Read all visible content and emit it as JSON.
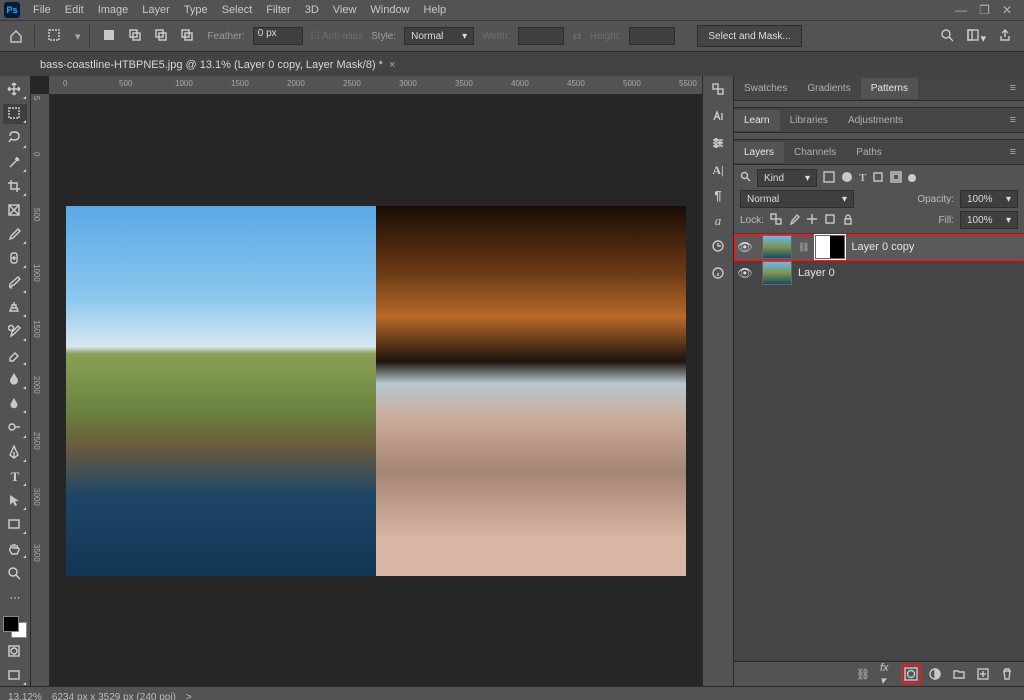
{
  "app": {
    "logo": "Ps"
  },
  "menu": [
    "File",
    "Edit",
    "Image",
    "Layer",
    "Type",
    "Select",
    "Filter",
    "3D",
    "View",
    "Window",
    "Help"
  ],
  "options": {
    "feather_label": "Feather:",
    "feather_value": "0 px",
    "antialias": "Anti-alias",
    "style_label": "Style:",
    "style_value": "Normal",
    "width_label": "Width:",
    "height_label": "Height:",
    "mask_button": "Select and Mask..."
  },
  "doc_tab": {
    "title": "bass-coastline-HTBPNE5.jpg @ 13.1% (Layer 0 copy, Layer Mask/8) *",
    "close": "×"
  },
  "ruler_h": [
    "0",
    "500",
    "1000",
    "1500",
    "2000",
    "2500",
    "3000",
    "3500",
    "4000",
    "4500",
    "5000",
    "5500"
  ],
  "ruler_v": [
    "5",
    "0",
    "500",
    "1000",
    "1500",
    "2000",
    "2500",
    "3000",
    "3500"
  ],
  "right": {
    "group1": [
      "Swatches",
      "Gradients",
      "Patterns"
    ],
    "group1_active": 2,
    "group2": [
      "Learn",
      "Libraries",
      "Adjustments"
    ],
    "group2_active": 0,
    "group3": [
      "Layers",
      "Channels",
      "Paths"
    ],
    "group3_active": 0
  },
  "layers": {
    "filter_label": "Kind",
    "blend": "Normal",
    "opacity_label": "Opacity:",
    "opacity": "100%",
    "lock_label": "Lock:",
    "fill_label": "Fill:",
    "fill": "100%",
    "items": [
      {
        "name": "Layer 0 copy",
        "has_mask": true,
        "selected": true,
        "highlight": true
      },
      {
        "name": "Layer 0",
        "has_mask": false,
        "selected": false,
        "highlight": false
      }
    ],
    "footer": [
      "link",
      "fx",
      "mask",
      "adjust",
      "group",
      "new",
      "trash"
    ]
  },
  "status": {
    "zoom": "13.12%",
    "doc": "6234 px x 3529 px (240 ppi)",
    "chev": ">"
  }
}
